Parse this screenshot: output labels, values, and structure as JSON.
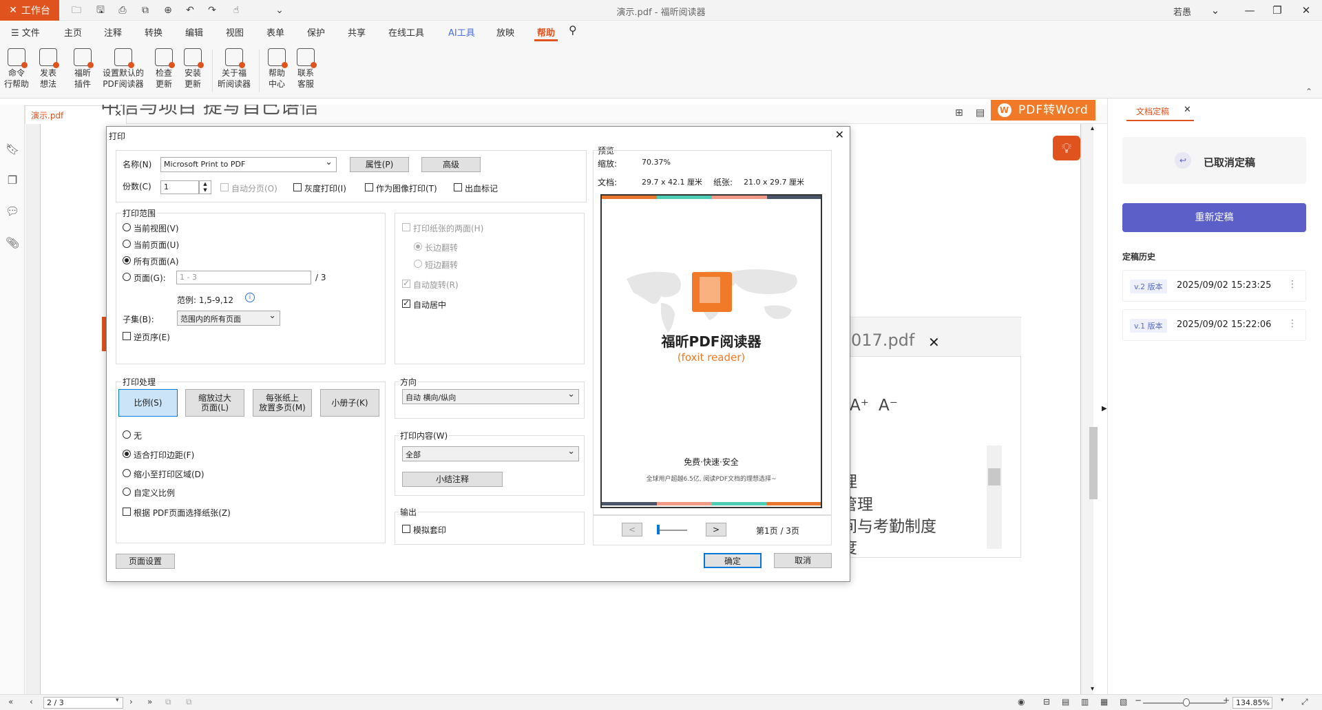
{
  "titlebar": {
    "workbench": "工作台",
    "doc_title": "演示.pdf - 福昕阅读器",
    "user": "若愚"
  },
  "menu": {
    "file": "文件",
    "items": [
      "主页",
      "注释",
      "转换",
      "编辑",
      "视图",
      "表单",
      "保护",
      "共享",
      "在线工具",
      "AI工具",
      "放映",
      "帮助"
    ]
  },
  "ribbon": [
    {
      "line1": "命令",
      "line2": "行帮助"
    },
    {
      "line1": "发表",
      "line2": "想法"
    },
    {
      "line1": "福昕",
      "line2": "插件"
    },
    {
      "line1": "设置默认的",
      "line2": "PDF阅读器"
    },
    {
      "line1": "检查",
      "line2": "更新"
    },
    {
      "line1": "安装",
      "line2": "更新"
    },
    {
      "line1": "关于福",
      "line2": "昕阅读器"
    },
    {
      "line1": "帮助",
      "line2": "中心"
    },
    {
      "line1": "联系",
      "line2": "客服"
    }
  ],
  "doc_tab": "演示.pdf",
  "pdf2word": "PDF转Word",
  "background_doc": {
    "filename": "017.pdf",
    "lines": [
      "理",
      "管理",
      "间与考勤制度",
      "度"
    ],
    "font_buttons": [
      "A⁺",
      "A⁻"
    ]
  },
  "right_panel": {
    "tab": "文档定稿",
    "cancelled": "已取消定稿",
    "reposition_button": "重新定稿",
    "history_title": "定稿历史",
    "history": [
      {
        "version": "v.2 版本",
        "time": "2025/09/02 15:23:25"
      },
      {
        "version": "v.1 版本",
        "time": "2025/09/02 15:22:06"
      }
    ]
  },
  "status": {
    "page": "2 / 3",
    "zoom": "134.85%"
  },
  "dialog": {
    "title": "打印",
    "name_label": "名称(N)",
    "printer": "Microsoft Print to PDF",
    "properties": "属性(P)",
    "advanced": "高级",
    "copies_label": "份数(C)",
    "copies": "1",
    "collate": "自动分页(O)",
    "grayscale": "灰度打印(I)",
    "as_image": "作为图像打印(T)",
    "bleed": "出血标记",
    "range_title": "打印范围",
    "range_current_view": "当前视图(V)",
    "range_current_page": "当前页面(U)",
    "range_all": "所有页面(A)",
    "range_pages": "页面(G):",
    "pages_placeholder": "1 - 3",
    "pages_total": "/ 3",
    "example": "范例:  1,5-9,12",
    "subset_label": "子集(B):",
    "subset_value": "范围内的所有页面",
    "reverse": "逆页序(E)",
    "duplex": "打印纸张的两面(H)",
    "long_edge": "长边翻转",
    "short_edge": "短边翻转",
    "auto_rotate": "自动旋转(R)",
    "auto_center": "自动居中",
    "handling_title": "打印处理",
    "scale_btn": "比例(S)",
    "fit_big_1": "缩放过大",
    "fit_big_2": "页面(L)",
    "multi_1": "每张纸上",
    "multi_2": "放置多页(M)",
    "booklet": "小册子(K)",
    "opt_none": "无",
    "opt_fit_margins": "适合打印边距(F)",
    "opt_shrink": "缩小至打印区域(D)",
    "opt_custom": "自定义比例",
    "opt_paper_by_pdf": "根据 PDF页面选择纸张(Z)",
    "orientation_title": "方向",
    "orientation_value": "自动 横向/纵向",
    "content_title": "打印内容(W)",
    "content_value": "全部",
    "summarize": "小结注释",
    "output_title": "输出",
    "simulate_overprint": "模拟套印",
    "page_setup": "页面设置",
    "ok": "确定",
    "cancel": "取消",
    "preview_title": "预览",
    "zoom_label": "缩放:",
    "zoom_value": "70.37%",
    "doc_label": "文档:",
    "doc_size": "29.7 x 42.1 厘米",
    "paper_label": "纸张:",
    "paper_size": "21.0 x 29.7 厘米",
    "page_indicator": "第1页 / 3页",
    "prev": "<",
    "next": ">",
    "preview_content": {
      "title": "福昕PDF阅读器",
      "subtitle": "(foxit reader)",
      "slogan": "免费·快速·安全",
      "desc": "全球用户超越6.5亿, 阅读PDF文档的理想选择~"
    }
  },
  "colors": {
    "accent": "#e0531f",
    "brand_orange": "#f07a27",
    "primary_purple": "#5b5fc7"
  }
}
